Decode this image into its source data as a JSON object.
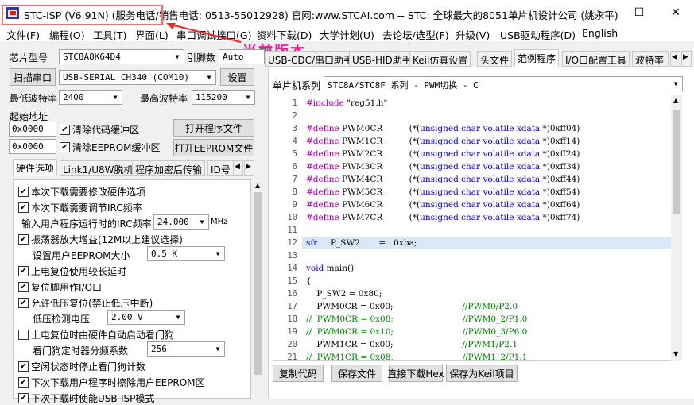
{
  "window": {
    "title_prefix": "STC-ISP (V6.91N)",
    "title_rest": " (服务电话/销售电话: 0513-55012928) 官网:www.STCAI.com  -- STC: 全球最大的8051单片机设计公司 (姚永平)",
    "minimize": "—",
    "maximize": "☐",
    "close": "✕"
  },
  "annotation": "当前版本",
  "menu": [
    "文件(F)",
    "编程(O)",
    "工具(T)",
    "界面(L)",
    "串口调试接口(G)",
    "资料下载(D)",
    "大学计划(U)",
    "去论坛/选型(F)",
    "升级(V)",
    "USB驱动程序(D)",
    "English"
  ],
  "left": {
    "chip_label": "芯片型号",
    "chip_value": "STC8A8K64D4",
    "pin_label": "引脚数",
    "pin_value": "Auto",
    "scan_button": "扫描串口",
    "port_value": "USB-SERIAL CH340 (COM10)",
    "settings_button": "设置",
    "min_baud_label": "最低波特率",
    "min_baud_value": "2400",
    "max_baud_label": "最高波特率",
    "max_baud_value": "115200",
    "start_addr_label": "起始地址",
    "addr1": "0x0000",
    "clear_code": "清除代码缓冲区",
    "open_prog": "打开程序文件",
    "addr2": "0x0000",
    "clear_eeprom": "清除EEPROM缓冲区",
    "open_eeprom": "打开EEPROM文件",
    "tabs": [
      "硬件选项",
      "Link1/U8W脱机",
      "程序加密后传输",
      "ID号"
    ],
    "options": [
      {
        "label": "本次下载需要修改硬件选项",
        "checked": true
      },
      {
        "label": "本次下载需要调节IRC频率",
        "checked": true
      },
      {
        "label": "输入用户程序运行时的IRC频率"
      },
      {
        "label": "振荡器放大增益(12M以上建议选择)",
        "checked": true
      },
      {
        "label": "设置用户EEPROM大小"
      },
      {
        "label": "上电复位使用较长延时",
        "checked": true
      },
      {
        "label": "复位脚用作I/O口",
        "checked": true
      },
      {
        "label": "允许低压复位(禁止低压中断)",
        "checked": true
      },
      {
        "label": "低压检测电压"
      },
      {
        "label": "上电复位时由硬件自动启动看门狗",
        "checked": false
      },
      {
        "label": "看门狗定时器分频系数"
      },
      {
        "label": "空闲状态时停止看门狗计数",
        "checked": true
      },
      {
        "label": "下次下载用户程序时擦除用户EEPROM区",
        "checked": true
      },
      {
        "label": "下次下载时使能USB-ISP模式",
        "checked": true
      }
    ],
    "irc_value": "24.000",
    "irc_unit": "MHz",
    "eeprom_value": "0.5 K",
    "lvd_value": "2.00 V",
    "wdt_value": "256"
  },
  "right": {
    "tabs": [
      "USB-CDC/串口助手",
      "USB-HID助手",
      "Keil仿真设置",
      "头文件",
      "范例程序",
      "I/O口配置工具",
      "波特率"
    ],
    "series_label": "单片机系列",
    "series_value": "STC8A/STC8F 系列 - PWM切换 - C",
    "code": [
      "#include \"reg51.h\"",
      "",
      "#define PWM0CR          (*(unsigned char volatile xdata *)0xff04)",
      "#define PWM1CR          (*(unsigned char volatile xdata *)0xff14)",
      "#define PWM2CR          (*(unsigned char volatile xdata *)0xff24)",
      "#define PWM3CR          (*(unsigned char volatile xdata *)0xff34)",
      "#define PWM4CR          (*(unsigned char volatile xdata *)0xff44)",
      "#define PWM5CR          (*(unsigned char volatile xdata *)0xff54)",
      "#define PWM6CR          (*(unsigned char volatile xdata *)0xff64)",
      "#define PWM7CR          (*(unsigned char volatile xdata *)0xff74)",
      "",
      "sfr     P_SW2       =   0xba;",
      "",
      "void main()",
      "{",
      "    P_SW2 = 0x80;",
      "    PWM0CR = 0x00;                          //PWM0/P2.0",
      "//  PWM0CR = 0x08;                          //PWM0_2/P1.0",
      "//  PWM0CR = 0x10;                          //PWM0_3/P6.0",
      "    PWM1CR = 0x00;                          //PWM1/P2.1",
      "//  PWM1CR = 0x08;                          //PWM1_2/P1.1"
    ],
    "buttons": [
      "复制代码",
      "保存文件",
      "直接下载Hex",
      "保存为Keil项目"
    ]
  }
}
